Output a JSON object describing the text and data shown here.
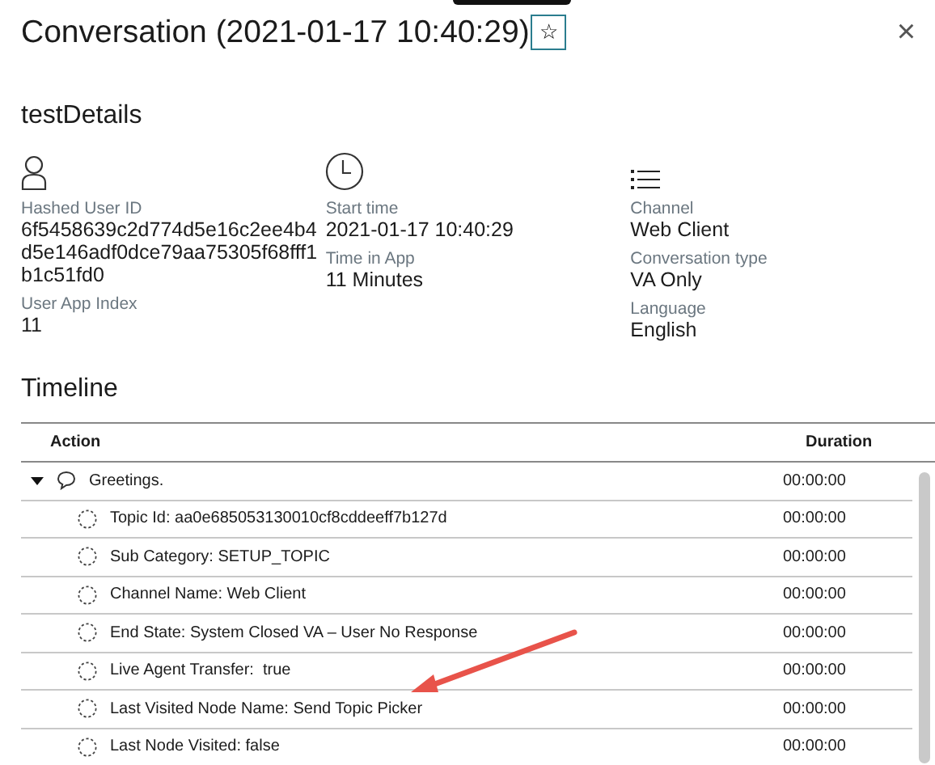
{
  "dialog": {
    "title": "Conversation (2021-01-17 10:40:29)",
    "favorite": {
      "selected": false,
      "icon": "☆"
    },
    "close": "×"
  },
  "details": {
    "title": "testDetails",
    "columns": [
      {
        "kind": "user",
        "fields": [
          {
            "label": "Hashed User ID",
            "value": "6f5458639c2d774d5e16c2ee4b4d5e146adf0dce79aa75305f68fff1b1c51fd0"
          },
          {
            "label": "User App Index",
            "value": "11"
          }
        ]
      },
      {
        "kind": "clock",
        "fields": [
          {
            "label": "Start time",
            "value": "2021-01-17 10:40:29"
          },
          {
            "label": "Time in App",
            "value": "11 Minutes"
          }
        ]
      },
      {
        "kind": "list",
        "fields": [
          {
            "label": "Channel",
            "value": "Web Client"
          },
          {
            "label": "Conversation type",
            "value": "VA Only"
          },
          {
            "label": "Language",
            "value": "English"
          }
        ]
      }
    ]
  },
  "timeline": {
    "title": "Timeline",
    "columns": [
      "Action",
      "Duration"
    ],
    "rows": [
      {
        "action": "Greetings.",
        "duration": "00:00:00",
        "expanded": true,
        "children": [
          {
            "action": "Topic Id: aa0e685053130010cf8cddeeff7b127d",
            "duration": "00:00:00"
          },
          {
            "action": "Sub Category: SETUP_TOPIC",
            "duration": "00:00:00"
          },
          {
            "action": "Channel Name: Web Client",
            "duration": "00:00:00"
          },
          {
            "action": "End State: System Closed VA – User No Response",
            "duration": "00:00:00"
          },
          {
            "action": "Live Agent Transfer:  true",
            "duration": "00:00:00"
          },
          {
            "action": "Last Visited Node Name: Send Topic Picker",
            "duration": "00:00:00"
          },
          {
            "action": "Last Node Visited: false",
            "duration": "00:00:00"
          }
        ]
      }
    ]
  }
}
